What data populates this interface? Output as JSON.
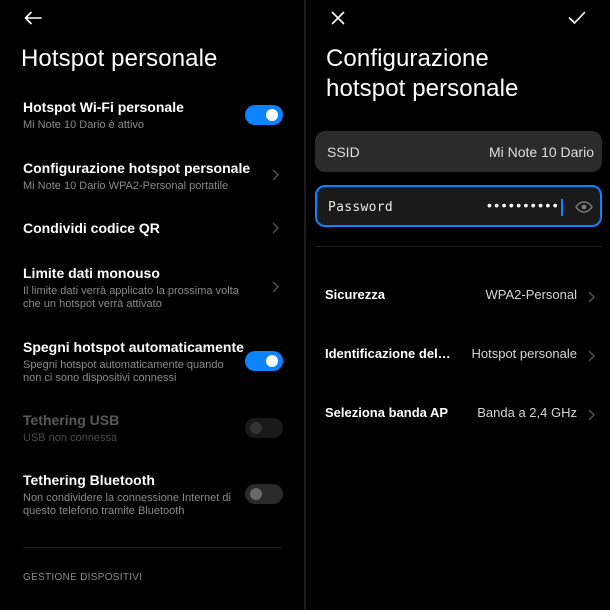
{
  "left": {
    "title": "Hotspot personale",
    "rows": [
      {
        "title": "Hotspot Wi-Fi personale",
        "sub": "Mi Note 10 Dario è attivo",
        "control": "toggle-on"
      },
      {
        "title": "Configurazione hotspot personale",
        "sub": "Mi Note 10 Dario WPA2-Personal portatile",
        "control": "chevron"
      },
      {
        "title": "Condividi codice QR",
        "sub": "",
        "control": "chevron"
      },
      {
        "title": "Limite dati monouso",
        "sub": "Il limite dati verrà applicato la prossima volta che un hotspot verrà attivato",
        "control": "chevron"
      },
      {
        "title": "Spegni hotspot automaticamente",
        "sub": "Spegni hotspot automaticamente quando non ci sono dispositivi connessi",
        "control": "toggle-on"
      },
      {
        "title": "Tethering USB",
        "sub": "USB non connessa",
        "control": "toggle-disabled"
      },
      {
        "title": "Tethering Bluetooth",
        "sub": "Non condividere la connessione Internet di questo telefono tramite Bluetooth",
        "control": "toggle-off"
      }
    ],
    "section_label": "GESTIONE DISPOSITIVI"
  },
  "right": {
    "title_line1": "Configurazione",
    "title_line2": "hotspot personale",
    "ssid": {
      "label": "SSID",
      "value": "Mi Note 10 Dario"
    },
    "password": {
      "label": "Password",
      "masked": "••••••••••"
    },
    "rows": [
      {
        "title": "Sicurezza",
        "value": "WPA2-Personal"
      },
      {
        "title": "Identificazione del…",
        "value": "Hotspot personale"
      },
      {
        "title": "Seleziona banda AP",
        "value": "Banda a 2,4 GHz"
      }
    ]
  },
  "icons": {
    "back": "arrow-left-icon",
    "close": "close-icon",
    "confirm": "check-icon",
    "chevron": "chevron-right-icon",
    "eye": "eye-icon"
  },
  "colors": {
    "accent": "#0d84ff",
    "background": "#000000",
    "field": "#2b2b2b"
  }
}
